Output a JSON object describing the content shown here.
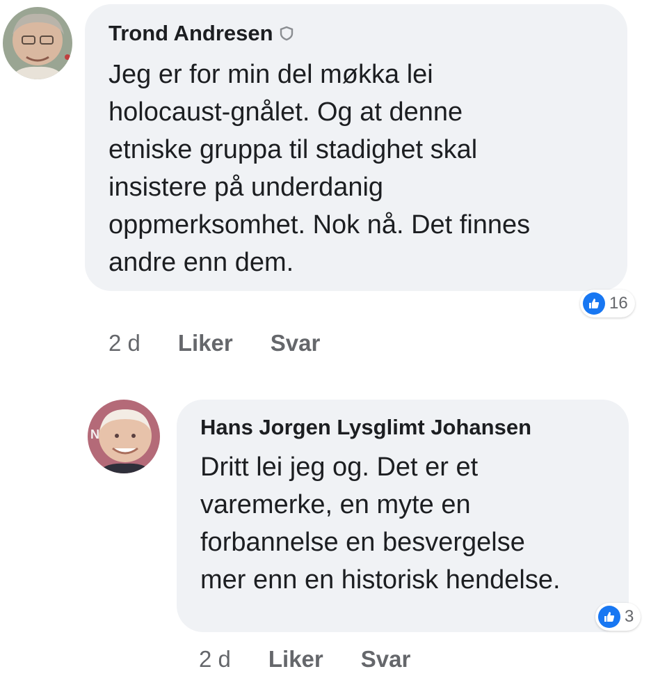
{
  "comments": [
    {
      "author": "Trond Andresen",
      "author_badge_icon": "top-fan-shield-icon",
      "body": [
        "Jeg er for min del møkka lei",
        "holocaust-gnålet. Og at denne",
        "etniske gruppa til stadighet skal",
        "insistere på underdanig",
        "oppmerksomhet. Nok nå. Det finnes",
        "andre enn dem."
      ],
      "reaction_icon": "like-icon",
      "reaction_count": "16",
      "time": "2 d",
      "like_label": "Liker",
      "reply_label": "Svar"
    },
    {
      "author": "Hans Jorgen Lysglimt Johansen",
      "body": [
        "Dritt lei jeg og. Det er et",
        "varemerke, en myte en",
        "forbannelse en besvergelse",
        "mer enn en historisk hendelse."
      ],
      "reaction_icon": "like-icon",
      "reaction_count": "3",
      "time": "2 d",
      "like_label": "Liker",
      "reply_label": "Svar"
    }
  ],
  "colors": {
    "bubble": "#f0f2f5",
    "text": "#1c1e21",
    "meta": "#65676b",
    "like_blue": "#1877f2"
  }
}
